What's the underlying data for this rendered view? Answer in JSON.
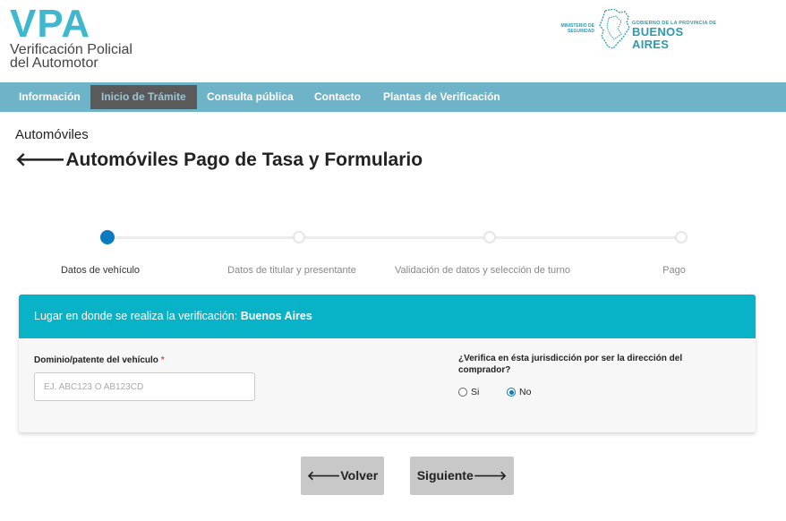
{
  "header": {
    "logo_main": "VPA",
    "logo_line1": "Verificación Policial",
    "logo_line2": "del Automotor",
    "gov_ministry_line1": "MINISTERIO DE",
    "gov_ministry_line2": "SEGURIDAD",
    "gov_top": "GOBIERNO DE LA PROVINCIA DE",
    "gov_name": "BUENOS AIRES"
  },
  "nav": {
    "items": [
      {
        "label": "Información"
      },
      {
        "label": "Inicio de Trámite"
      },
      {
        "label": "Consulta pública"
      },
      {
        "label": "Contacto"
      },
      {
        "label": "Plantas de Verificación"
      }
    ]
  },
  "breadcrumb": "Automóviles",
  "page_title": "Automóviles Pago de Tasa y Formulario",
  "back_arrow": "🡐",
  "stepper": {
    "active_index": 0,
    "steps": [
      {
        "label": "Datos de vehículo"
      },
      {
        "label": "Datos de titular y presentante"
      },
      {
        "label": "Validación de datos y selección de turno"
      },
      {
        "label": "Pago"
      }
    ]
  },
  "card": {
    "header_prefix": "Lugar en donde se realiza la verificación: ",
    "header_place": "Buenos Aires",
    "plate_label": "Dominio/patente del vehículo",
    "required_mark": "*",
    "plate_value": "",
    "plate_placeholder": "EJ. ABC123 O AB123CD",
    "question_line1": "¿Verifica en ésta jurisdicción por ser la dirección del",
    "question_line2": "comprador?",
    "options": [
      {
        "label": "Si",
        "checked": false
      },
      {
        "label": "No",
        "checked": true
      }
    ]
  },
  "buttons": {
    "back": "🡐Volver",
    "next": "Siguiente🡒"
  },
  "colors": {
    "brand": "#3fb7cf",
    "nav_bg": "#6fb3c9",
    "card_header": "#08b3c8",
    "step_active": "#0c7abf"
  }
}
